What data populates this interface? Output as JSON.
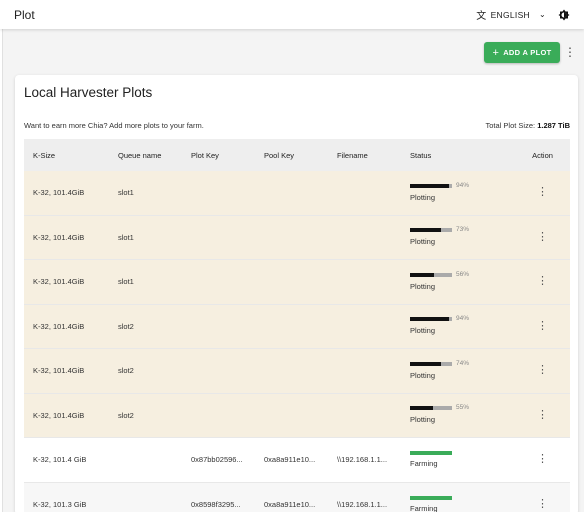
{
  "app": {
    "title": "Plot"
  },
  "header": {
    "language": "ENGLISH"
  },
  "toolbar": {
    "add_plot_label": "ADD A PLOT"
  },
  "card": {
    "title": "Local Harvester Plots",
    "subtext": "Want to earn more Chia? Add more plots to your farm.",
    "total_label": "Total Plot Size:",
    "total_value": "1.287 TiB"
  },
  "columns": [
    "K-Size",
    "Queue name",
    "Plot Key",
    "Pool Key",
    "Filename",
    "Status",
    "Action"
  ],
  "queue_rows": [
    {
      "ksize": "K-32, 101.4GiB",
      "queue": "slot1",
      "progress": 94,
      "pct_label": "94%",
      "status": "Plotting"
    },
    {
      "ksize": "K-32, 101.4GiB",
      "queue": "slot1",
      "progress": 73,
      "pct_label": "73%",
      "status": "Plotting"
    },
    {
      "ksize": "K-32, 101.4GiB",
      "queue": "slot1",
      "progress": 56,
      "pct_label": "56%",
      "status": "Plotting"
    },
    {
      "ksize": "K-32, 101.4GiB",
      "queue": "slot2",
      "progress": 94,
      "pct_label": "94%",
      "status": "Plotting"
    },
    {
      "ksize": "K-32, 101.4GiB",
      "queue": "slot2",
      "progress": 74,
      "pct_label": "74%",
      "status": "Plotting"
    },
    {
      "ksize": "K-32, 101.4GiB",
      "queue": "slot2",
      "progress": 55,
      "pct_label": "55%",
      "status": "Plotting"
    }
  ],
  "farm_rows": [
    {
      "ksize": "K-32, 101.4 GiB",
      "plot_key": "0x87bb02596...",
      "pool_key": "0xa8a911e10...",
      "filename": "\\\\192.168.1.1...",
      "status": "Farming"
    },
    {
      "ksize": "K-32, 101.3 GiB",
      "plot_key": "0x8598f3295...",
      "pool_key": "0xa8a911e10...",
      "filename": "\\\\192.168.1.1...",
      "status": "Farming"
    }
  ],
  "colors": {
    "accent": "#3aac59",
    "queue_bg": "#f6efe0"
  },
  "icons": {
    "language": "translate-icon",
    "theme": "dark-mode-icon",
    "more": "more-vert-icon"
  }
}
